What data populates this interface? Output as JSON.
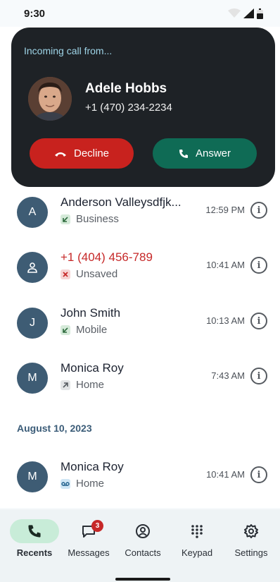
{
  "status_bar": {
    "time": "9:30"
  },
  "incoming_call": {
    "title": "Incoming call from...",
    "caller_name": "Adele Hobbs",
    "caller_number": "+1 (470) 234-2234",
    "decline_label": "Decline",
    "answer_label": "Answer"
  },
  "recents": [
    {
      "initial": "A",
      "name": "Anderson Valleysdfjk...",
      "type": "Business",
      "direction": "incoming",
      "time": "12:59 PM",
      "missed": false
    },
    {
      "initial": "",
      "name": "+1 (404) 456-789",
      "type": "Unsaved",
      "direction": "missed",
      "time": "10:41 AM",
      "missed": true
    },
    {
      "initial": "J",
      "name": "John Smith",
      "type": "Mobile",
      "direction": "incoming",
      "time": "10:13 AM",
      "missed": false
    },
    {
      "initial": "M",
      "name": "Monica Roy",
      "type": "Home",
      "direction": "outgoing",
      "time": "7:43 AM",
      "missed": false
    }
  ],
  "date_header": "August 10, 2023",
  "recents_older": [
    {
      "initial": "M",
      "name": "Monica Roy",
      "type": "Home",
      "direction": "voicemail",
      "time": "10:41 AM",
      "missed": false
    }
  ],
  "nav": {
    "recents": "Recents",
    "messages": "Messages",
    "messages_badge": "3",
    "contacts": "Contacts",
    "keypad": "Keypad",
    "settings": "Settings"
  },
  "colors": {
    "card_bg": "#1e2226",
    "decline": "#c8221e",
    "answer": "#0f6b55",
    "avatar": "#3e5c74",
    "missed": "#c62828",
    "active_nav": "#c8ecd8"
  }
}
